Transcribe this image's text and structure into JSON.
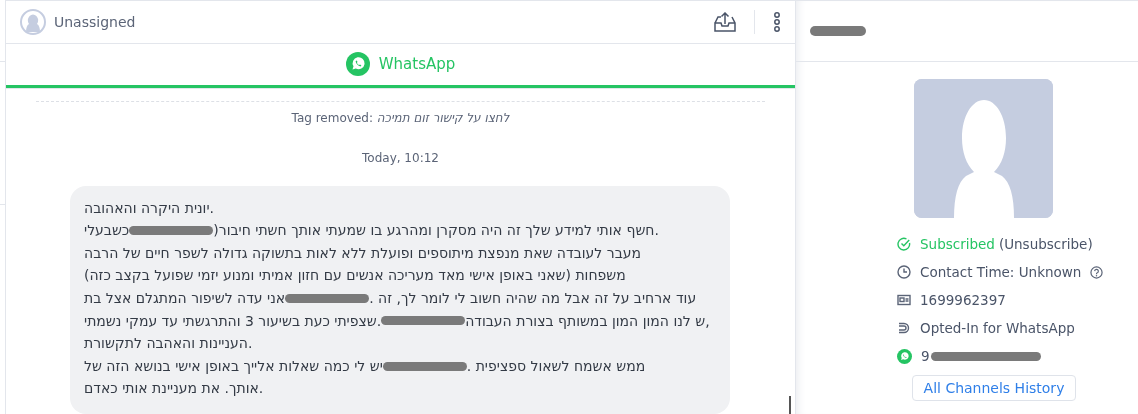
{
  "conversation": {
    "assignee": "Unassigned"
  },
  "channel_tabs": [
    {
      "label": "WhatsApp",
      "selected": true
    }
  ],
  "events": [
    {
      "kind": "tag",
      "label": "Tag removed:",
      "value": "לחצו על קישור זום תמיכה"
    },
    {
      "kind": "time",
      "label": "Today, 10:12"
    }
  ],
  "message": {
    "lines": [
      [
        {
          "kind": "text",
          "text": "יונית היקרה והאהובה."
        }
      ],
      [
        {
          "kind": "text",
          "text": "חשף אותי למידע שלך זה היה מסקרן ומהרגע בו שמעתי אותך חשתי חיבור."
        },
        {
          "kind": "text",
          "text": ")"
        },
        {
          "kind": "redacted"
        },
        {
          "kind": "text",
          "text": "כשבעלי"
        }
      ],
      [
        {
          "kind": "text",
          "text": "מעבר לעובדה שאת מנפצת מיתוספים ופועלת ללא לאות בתשוקה גדולה לשפר חיים של הרבה"
        }
      ],
      [
        {
          "kind": "text",
          "text": "משפחות (שאני באופן אישי מאד מעריכה אנשים עם חזון אמיתי ומנוע יזמי שפועל בקצב כזה)"
        }
      ],
      [
        {
          "kind": "text",
          "text": ". עוד ארחיב על זה אבל מה שהיה חשוב לי לומר לך, זה"
        },
        {
          "kind": "redacted"
        },
        {
          "kind": "text",
          "text": "אני עדה לשיפור המתגלם אצל בת"
        }
      ],
      [
        {
          "kind": "text",
          "text": "ש לנו המון המון במשותף בצורת העבודה,"
        },
        {
          "kind": "redacted"
        },
        {
          "kind": "text",
          "text": "שצפיתי כעת בשיעור 3 והתרגשתי עד עמקי נשמתי."
        }
      ],
      [
        {
          "kind": "text",
          "text": "העניינות והאהבה לתקשורת."
        }
      ],
      [
        {
          "kind": "text",
          "text": ". ממש אשמח לשאול ספציפית"
        },
        {
          "kind": "redacted"
        },
        {
          "kind": "text",
          "text": "יש לי כמה שאלות אלייך באופן אישי בנושא הזה של"
        }
      ],
      [
        {
          "kind": "text",
          "text": "אותך. את מעניינת אותי כאדם."
        }
      ]
    ]
  },
  "contact": {
    "details": [
      {
        "kind": "subscribed",
        "status": "Subscribed",
        "action": "(Unsubscribe)"
      },
      {
        "kind": "time",
        "text": "Contact Time: Unknown"
      },
      {
        "kind": "id",
        "text": "1699962397"
      },
      {
        "kind": "optin",
        "text": "Opted-In for WhatsApp"
      },
      {
        "kind": "whatsapp",
        "text": "9"
      }
    ],
    "history_button": "All Channels History"
  }
}
